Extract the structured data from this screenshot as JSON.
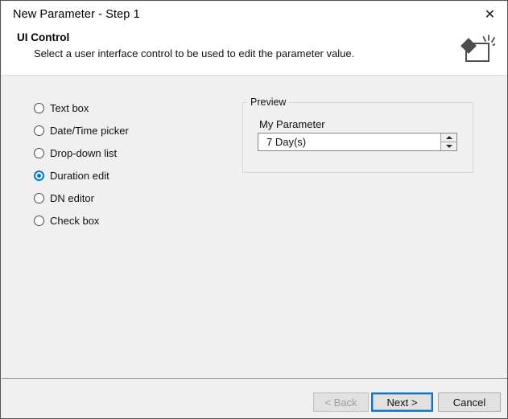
{
  "window": {
    "title": "New Parameter - Step 1",
    "close_icon": "close-icon",
    "close_label": "✕"
  },
  "header": {
    "title": "UI Control",
    "subtitle": "Select a user interface control to be used to edit the parameter value.",
    "icon": "parameter-control-icon"
  },
  "control_options": {
    "items": [
      {
        "label": "Text box",
        "selected": false
      },
      {
        "label": "Date/Time picker",
        "selected": false
      },
      {
        "label": "Drop-down list",
        "selected": false
      },
      {
        "label": "Duration edit",
        "selected": true
      },
      {
        "label": "DN editor",
        "selected": false
      },
      {
        "label": "Check box",
        "selected": false
      }
    ],
    "selected_value": "Duration edit"
  },
  "preview": {
    "legend": "Preview",
    "parameter_label": "My Parameter",
    "parameter_value": "7 Day(s)",
    "spinner_up_icon": "chevron-up-icon",
    "spinner_down_icon": "chevron-down-icon"
  },
  "footer": {
    "back_label": "< Back",
    "next_label": "Next >",
    "cancel_label": "Cancel",
    "back_disabled": true,
    "default_button": "Next >"
  },
  "colors": {
    "accent": "#0078d7",
    "dialog_background": "#f0f0f0",
    "header_background": "#ffffff",
    "button_face": "#e1e1e1",
    "text": "#111111",
    "disabled_text": "#9d9d9d"
  }
}
